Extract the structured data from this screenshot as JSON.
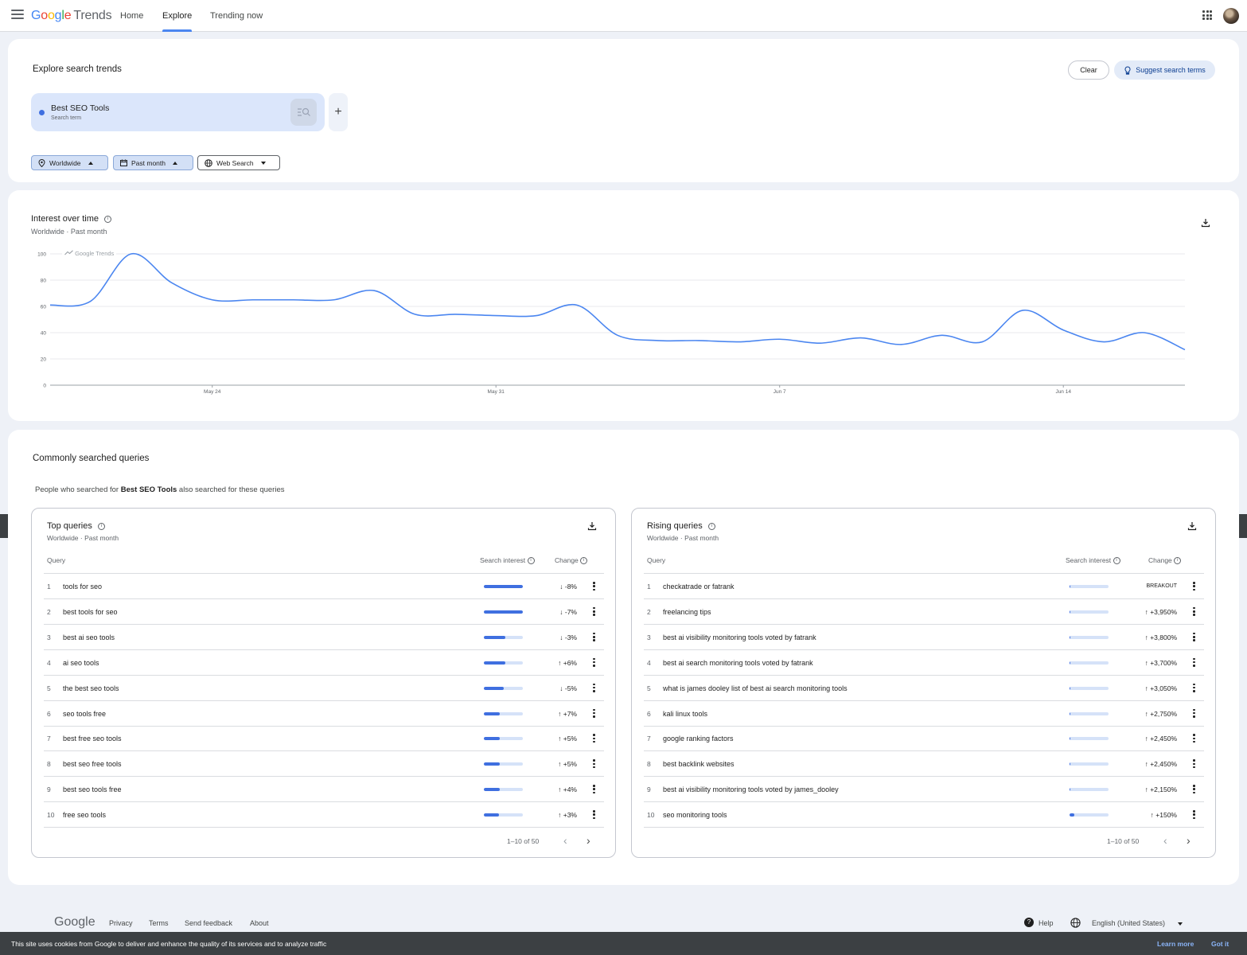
{
  "header": {
    "logo": {
      "g1": "G",
      "g2": "o",
      "g3": "o",
      "g4": "g",
      "g5": "l",
      "g6": "e",
      "trends": "Trends"
    },
    "nav": [
      "Home",
      "Explore",
      "Trending now"
    ],
    "active_nav": "Explore"
  },
  "explore": {
    "title": "Explore search trends",
    "clear_label": "Clear",
    "suggest_label": "Suggest search terms",
    "term": {
      "name": "Best SEO Tools",
      "type": "Search term",
      "color": "#3f6fe0"
    },
    "add_label": "+",
    "filters": {
      "region": "Worldwide",
      "period": "Past month",
      "property": "Web Search"
    }
  },
  "interest": {
    "title": "Interest over time",
    "subtitle": "Worldwide · Past month",
    "watermark": "Google Trends"
  },
  "chart_data": {
    "type": "line",
    "title": "Interest over time",
    "ylim": [
      0,
      100
    ],
    "yticks": [
      0,
      20,
      40,
      60,
      80,
      100
    ],
    "xtick_labels": [
      "May 24",
      "May 31",
      "Jun 7",
      "Jun 14"
    ],
    "xtick_index": [
      4,
      11,
      18,
      25
    ],
    "series": [
      {
        "color": "#4b86f0",
        "x": [
          "May 20",
          "May 21",
          "May 22",
          "May 23",
          "May 24",
          "May 25",
          "May 26",
          "May 27",
          "May 28",
          "May 29",
          "May 30",
          "May 31",
          "Jun 1",
          "Jun 2",
          "Jun 3",
          "Jun 4",
          "Jun 5",
          "Jun 6",
          "Jun 7",
          "Jun 8",
          "Jun 9",
          "Jun 10",
          "Jun 11",
          "Jun 12",
          "Jun 13",
          "Jun 14",
          "Jun 15",
          "Jun 16",
          "Jun 17"
        ],
        "values": [
          61,
          64,
          100,
          78,
          65,
          65,
          65,
          65,
          72,
          54,
          54,
          53,
          53,
          61,
          38,
          34,
          34,
          33,
          35,
          32,
          36,
          31,
          38,
          33,
          57,
          42,
          33,
          40,
          27
        ]
      }
    ]
  },
  "queries": {
    "title": "Commonly searched queries",
    "intro": {
      "before": "People who searched for ",
      "term": "Best SEO Tools",
      "after": " also searched for these queries"
    },
    "top": {
      "title": "Top queries",
      "subtitle": "Worldwide · Past month",
      "col_query": "Query",
      "col_interest": "Search interest",
      "col_change": "Change",
      "pager": "1–10 of 50",
      "rows": [
        {
          "rank": "1",
          "query": "tools for seo",
          "interest": 1.0,
          "change": "↓ -8%"
        },
        {
          "rank": "2",
          "query": "best tools for seo",
          "interest": 1.0,
          "change": "↓ -7%"
        },
        {
          "rank": "3",
          "query": "best ai seo tools",
          "interest": 0.55,
          "change": "↓ -3%"
        },
        {
          "rank": "4",
          "query": "ai seo tools",
          "interest": 0.55,
          "change": "↑ +6%"
        },
        {
          "rank": "5",
          "query": "the best seo tools",
          "interest": 0.5,
          "change": "↓ -5%"
        },
        {
          "rank": "6",
          "query": "seo tools free",
          "interest": 0.4,
          "change": "↑ +7%"
        },
        {
          "rank": "7",
          "query": "best free seo tools",
          "interest": 0.4,
          "change": "↑ +5%"
        },
        {
          "rank": "8",
          "query": "best seo free tools",
          "interest": 0.4,
          "change": "↑ +5%"
        },
        {
          "rank": "9",
          "query": "best seo tools free",
          "interest": 0.4,
          "change": "↑ +4%"
        },
        {
          "rank": "10",
          "query": "free seo tools",
          "interest": 0.38,
          "change": "↑ +3%"
        }
      ]
    },
    "rising": {
      "title": "Rising queries",
      "subtitle": "Worldwide · Past month",
      "col_query": "Query",
      "col_interest": "Search interest",
      "col_change": "Change",
      "pager": "1–10 of 50",
      "rows": [
        {
          "rank": "1",
          "query": "checkatrade or fatrank",
          "interest": 0.03,
          "change": "BREAKOUT"
        },
        {
          "rank": "2",
          "query": "freelancing tips",
          "interest": 0.03,
          "change": "↑ +3,950%"
        },
        {
          "rank": "3",
          "query": "best ai visibility monitoring tools voted by fatrank",
          "interest": 0.03,
          "change": "↑ +3,800%"
        },
        {
          "rank": "4",
          "query": "best ai search monitoring tools voted by fatrank",
          "interest": 0.03,
          "change": "↑ +3,700%"
        },
        {
          "rank": "5",
          "query": "what is james dooley list of best ai search monitoring tools",
          "interest": 0.03,
          "change": "↑ +3,050%"
        },
        {
          "rank": "6",
          "query": "kali linux tools",
          "interest": 0.03,
          "change": "↑ +2,750%"
        },
        {
          "rank": "7",
          "query": "google ranking factors",
          "interest": 0.03,
          "change": "↑ +2,450%"
        },
        {
          "rank": "8",
          "query": "best backlink websites",
          "interest": 0.03,
          "change": "↑ +2,450%"
        },
        {
          "rank": "9",
          "query": "best ai visibility monitoring tools voted by james_dooley",
          "interest": 0.03,
          "change": "↑ +2,150%"
        },
        {
          "rank": "10",
          "query": "seo monitoring tools",
          "interest": 0.12,
          "change": "↑   +150%"
        }
      ]
    }
  },
  "footer": {
    "logo": "Google",
    "links": [
      "Privacy",
      "Terms",
      "Send feedback",
      "About"
    ],
    "help": "Help",
    "language": "English (United States)"
  },
  "cookie": {
    "text": "This site uses cookies from Google to deliver and enhance the quality of its services and to analyze traffic",
    "learn_more": "Learn more",
    "got_it": "Got it"
  }
}
